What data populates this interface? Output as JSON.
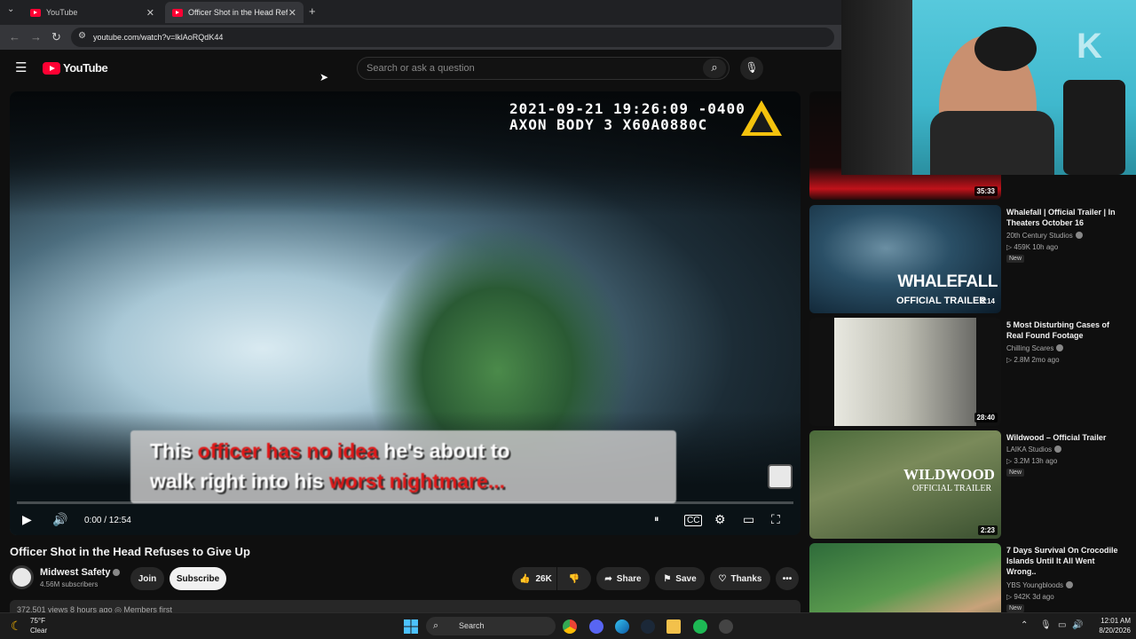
{
  "browser": {
    "tabs": [
      {
        "title": "YouTube",
        "active": false
      },
      {
        "title": "Officer Shot in the Head Refuse",
        "active": true
      }
    ],
    "url": "youtube.com/watch?v=lklAoRQdK44"
  },
  "masthead": {
    "logo_text": "YouTube",
    "search_placeholder": "Search or ask a question"
  },
  "player": {
    "timestamp_line": "2021-09-21 19:26:09 -0400",
    "device_line": "AXON BODY 3 X60A0880C",
    "caption": {
      "line1": [
        {
          "text": "This ",
          "red": false
        },
        {
          "text": "officer has no idea",
          "red": true
        },
        {
          "text": " he's about to",
          "red": false
        }
      ],
      "line2": [
        {
          "text": "walk right into his ",
          "red": false
        },
        {
          "text": "worst nightmare...",
          "red": true
        }
      ]
    },
    "time": "0:00 / 12:54",
    "progress": 0.0
  },
  "video": {
    "title": "Officer Shot in the Head Refuses to Give Up",
    "channel": "Midwest Safety",
    "subscribers": "4.56M subscribers",
    "join_label": "Join",
    "subscribe_label": "Subscribe",
    "likes": "26K",
    "share_label": "Share",
    "save_label": "Save",
    "thanks_label": "Thanks",
    "meta": "372,501 views  8 hours ago  ◎ Members first"
  },
  "sidebar": [
    {
      "title": "",
      "channel": "",
      "stats": "",
      "duration": "35:33",
      "is_new": false
    },
    {
      "title": "Whalefall | Official Trailer | In Theaters October 16",
      "channel": "20th Century Studios",
      "stats": "▷ 459K  10h ago",
      "duration": "2:14",
      "is_new": true,
      "thumb_text": [
        "WHALEFALL",
        "OFFICIAL TRAILER"
      ]
    },
    {
      "title": "5 Most Disturbing Cases of Real Found Footage",
      "channel": "Chilling Scares",
      "stats": "▷ 2.8M  2mo ago",
      "duration": "28:40",
      "is_new": false
    },
    {
      "title": "Wildwood – Official Trailer",
      "channel": "LAIKA Studios",
      "stats": "▷ 3.2M  13h ago",
      "duration": "2:23",
      "is_new": true,
      "thumb_text": [
        "WILDWOOD",
        "OFFICIAL TRAILER"
      ]
    },
    {
      "title": "7 Days Survival On Crocodile Islands Until It All Went Wrong..",
      "channel": "YBS Youngbloods",
      "stats": "▷ 942K  3d ago",
      "duration": "",
      "is_new": true
    }
  ],
  "new_label": "New",
  "taskbar": {
    "temperature": "75°F",
    "condition": "Clear",
    "search_label": "Search",
    "time": "12:01 AM",
    "date": "8/20/2026"
  },
  "webcam_letter": "K",
  "colors": {
    "accent_red": "#ff0033",
    "background": "#0f0f0f",
    "pill": "#272727"
  }
}
